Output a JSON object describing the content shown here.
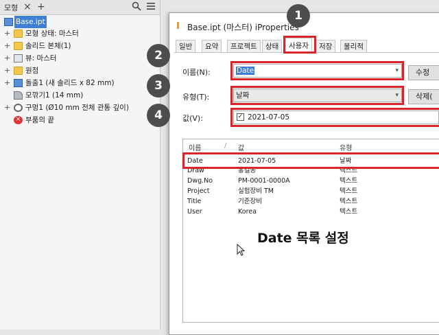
{
  "browser": {
    "tab_label": "모형",
    "tree": [
      {
        "label": "Base.ipt",
        "selected": true
      },
      {
        "label": "모형 상태: 마스터"
      },
      {
        "label": "솔리드 본체(1)"
      },
      {
        "label": "뷰: 마스터"
      },
      {
        "label": "원점"
      },
      {
        "label": "돌출1 (새 솔리드 x 82 mm)"
      },
      {
        "label": "모깎기1 (14 mm)"
      },
      {
        "label": "구멍1 (Ø10 mm 전체 관통 깊이)"
      },
      {
        "label": "부품의 끝"
      }
    ]
  },
  "dialog": {
    "title": "Base.ipt (마스터) iProperties",
    "tabs": [
      "일반",
      "요약",
      "프로젝트",
      "상태",
      "사용자",
      "저장",
      "물리적"
    ],
    "active_tab": "사용자",
    "name_label": "이름(N):",
    "name_value": "Date",
    "type_label": "유형(T):",
    "type_value": "날짜",
    "value_label": "값(V):",
    "value_value": "2021-07-05",
    "add_button": "수정",
    "delete_button": "삭제("
  },
  "list": {
    "headers": [
      "이름",
      "값",
      "유형"
    ],
    "rows": [
      {
        "name": "Date",
        "value": "2021-07-05",
        "type": "날짜"
      },
      {
        "name": "Draw",
        "value": "홍길동",
        "type": "텍스트"
      },
      {
        "name": "Dwg.No",
        "value": "PM-0001-0000A",
        "type": "텍스트"
      },
      {
        "name": "Project",
        "value": "실험장비 TM",
        "type": "텍스트"
      },
      {
        "name": "Title",
        "value": "기준장비",
        "type": "텍스트"
      },
      {
        "name": "User",
        "value": "Korea",
        "type": "텍스트"
      }
    ]
  },
  "badges": [
    "1",
    "2",
    "3",
    "4"
  ],
  "caption": "Date 목록 설정",
  "colors": {
    "highlight": "#d7262b",
    "badge": "#4d4d4d",
    "selection": "#3d7fd6"
  }
}
